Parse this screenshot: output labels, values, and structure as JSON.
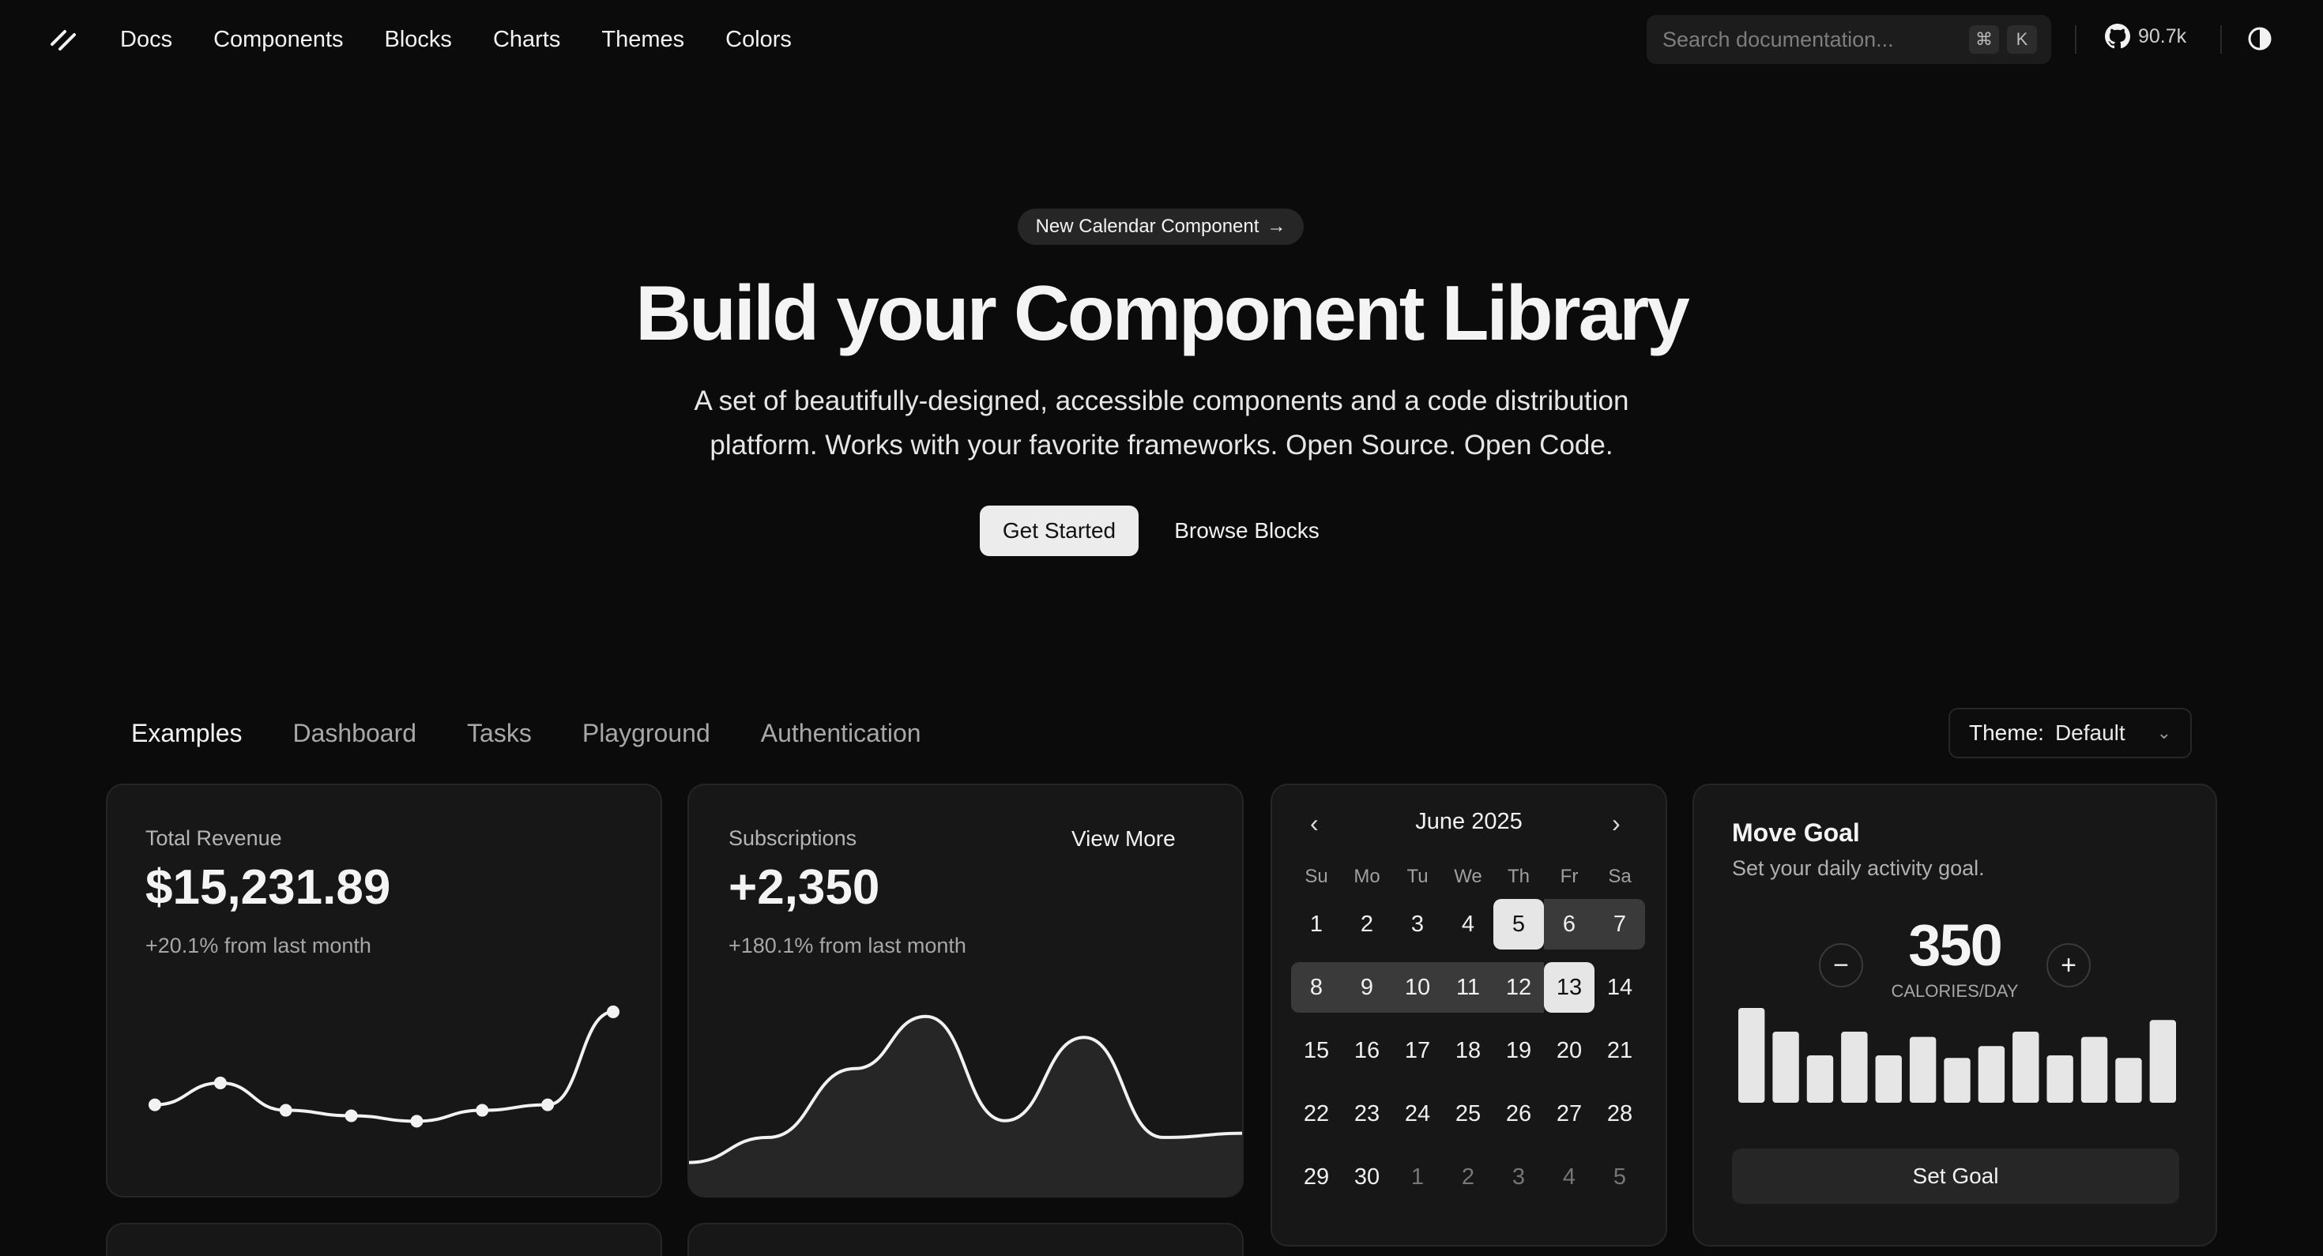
{
  "nav": {
    "items": [
      "Docs",
      "Components",
      "Blocks",
      "Charts",
      "Themes",
      "Colors"
    ]
  },
  "search": {
    "placeholder": "Search documentation...",
    "kbd_cmd": "⌘",
    "kbd_key": "K"
  },
  "github": {
    "stars": "90.7k"
  },
  "hero": {
    "badge": "New Calendar Component",
    "badge_arrow": "→",
    "title": "Build your Component Library",
    "subtitle_line1": "A set of beautifully-designed, accessible components and a code distribution",
    "subtitle_line2": "platform. Works with your favorite frameworks. Open Source. Open Code.",
    "primary_cta": "Get Started",
    "secondary_cta": "Browse Blocks"
  },
  "tabs": {
    "items": [
      "Examples",
      "Dashboard",
      "Tasks",
      "Playground",
      "Authentication"
    ],
    "active": "Examples"
  },
  "theme_select": {
    "label": "Theme:",
    "value": "Default"
  },
  "revenue": {
    "label": "Total Revenue",
    "value": "$15,231.89",
    "delta": "+20.1% from last month"
  },
  "subscriptions": {
    "label": "Subscriptions",
    "value": "+2,350",
    "delta": "+180.1% from last month",
    "action": "View More"
  },
  "calendar": {
    "month": "June 2025",
    "prev_icon": "chevron-left-icon",
    "next_icon": "chevron-right-icon",
    "weekdays": [
      "Su",
      "Mo",
      "Tu",
      "We",
      "Th",
      "Fr",
      "Sa"
    ],
    "weeks": [
      [
        "1",
        "2",
        "3",
        "4",
        "5",
        "6",
        "7"
      ],
      [
        "8",
        "9",
        "10",
        "11",
        "12",
        "13",
        "14"
      ],
      [
        "15",
        "16",
        "17",
        "18",
        "19",
        "20",
        "21"
      ],
      [
        "22",
        "23",
        "24",
        "25",
        "26",
        "27",
        "28"
      ],
      [
        "29",
        "30",
        "1",
        "2",
        "3",
        "4",
        "5"
      ]
    ],
    "range_start": 5,
    "range_end": 13
  },
  "goal": {
    "title": "Move Goal",
    "description": "Set your daily activity goal.",
    "value": "350",
    "unit": "CALORIES/DAY",
    "button": "Set Goal",
    "bars": [
      400,
      300,
      200,
      300,
      200,
      278,
      189,
      239,
      300,
      200,
      278,
      189,
      349
    ]
  },
  "chart_data": [
    {
      "type": "line",
      "series": [
        {
          "values": [
            28,
            32,
            27,
            26,
            25,
            27,
            28,
            45
          ]
        }
      ]
    },
    {
      "type": "area",
      "series": [
        {
          "values": [
            10,
            22,
            55,
            80,
            30,
            70,
            22,
            24
          ]
        }
      ]
    }
  ]
}
